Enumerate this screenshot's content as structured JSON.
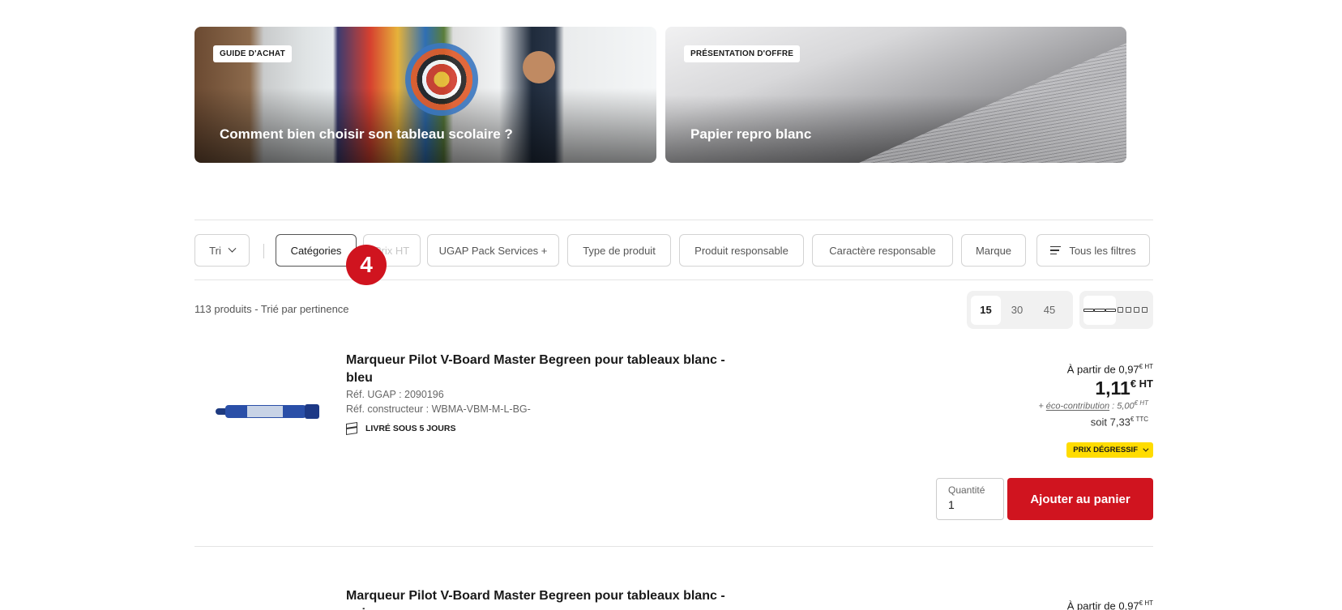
{
  "promos": [
    {
      "badge": "GUIDE D'ACHAT",
      "title": "Comment bien choisir son tableau scolaire ?"
    },
    {
      "badge": "PRÉSENTATION D'OFFRE",
      "title": "Papier repro blanc"
    }
  ],
  "filters": {
    "sort_label": "Tri",
    "chips": [
      "Catégories",
      "Prix HT",
      "UGAP Pack Services +",
      "Type de produit",
      "Produit responsable",
      "Caractère responsable",
      "Marque"
    ],
    "all_filters": "Tous les filtres"
  },
  "step_badge": "4",
  "results": {
    "count": "113 produits - Trié par pertinence",
    "per_page": [
      "15",
      "30",
      "45"
    ],
    "per_page_selected": "15"
  },
  "products": [
    {
      "title": "Marqueur Pilot V-Board Master Begreen pour tableaux blanc - bleu",
      "ref_ugap": "Réf. UGAP : 2090196",
      "ref_maker": "Réf. constructeur : WBMA-VBM-M-L-BG-",
      "delivery": "LIVRÉ SOUS 5 JOURS",
      "price_from_label": "À partir de 0,97",
      "price_unit_small": "€ HT",
      "price": "1,11",
      "price_unit": "€ HT",
      "eco_prefix": "+ ",
      "eco_label": "éco-contribution",
      "eco_value": " : 5,00",
      "ttc": "soit 7,33",
      "ttc_unit": "€ TTC",
      "degressive": "PRIX DÉGRESSIF",
      "quantity_label": "Quantité",
      "quantity": "1",
      "add_to_cart": "Ajouter au panier"
    },
    {
      "title": "Marqueur Pilot V-Board Master Begreen pour tableaux blanc - noir",
      "price_from_label": "À partir de 0,97",
      "price_unit_small": "€ HT"
    }
  ],
  "colors": {
    "accent_red": "#d0141f",
    "badge_yellow": "#ffdc00"
  }
}
